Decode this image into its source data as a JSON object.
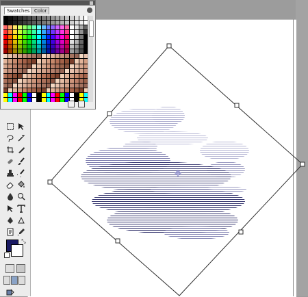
{
  "swatches_panel": {
    "tabs": [
      "Swatches",
      "Color"
    ],
    "active_tab": "Swatches"
  },
  "colors": {
    "foreground": "#1a1a63",
    "background": "#ffffff",
    "stroke": "#2f2f2f",
    "ink": "#262660"
  },
  "icons": {
    "tool": [
      "marquee-icon",
      "move-icon",
      "lasso-icon",
      "magic-wand-icon",
      "crop-icon",
      "slice-icon",
      "healing-brush-icon",
      "brush-icon",
      "clone-stamp-icon",
      "history-brush-icon",
      "eraser-icon",
      "paint-bucket-icon",
      "blur-icon",
      "dodge-icon",
      "path-selection-icon",
      "type-icon",
      "pen-icon",
      "shape-icon",
      "notes-icon",
      "eyedropper-icon",
      "hand-icon",
      "zoom-icon"
    ]
  }
}
